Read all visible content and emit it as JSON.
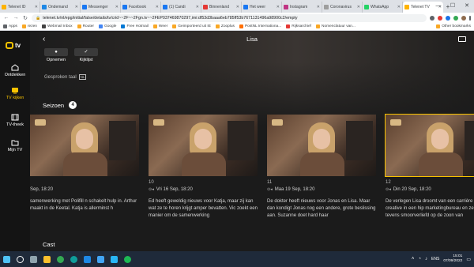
{
  "browser": {
    "tabs": [
      {
        "label": "Telenet ID",
        "color": "#ffb300"
      },
      {
        "label": "Ondemand",
        "color": "#1e88e5"
      },
      {
        "label": "Messenger",
        "color": "#1877f2"
      },
      {
        "label": "Facebook",
        "color": "#1877f2"
      },
      {
        "label": "(1) Candi",
        "color": "#1877f2"
      },
      {
        "label": "Binnenland",
        "color": "#e53935"
      },
      {
        "label": "Het weer",
        "color": "#1877f2"
      },
      {
        "label": "Instagram",
        "color": "#c13584"
      },
      {
        "label": "Coronavirus",
        "color": "#9e9e9e"
      },
      {
        "label": "WhatsApp",
        "color": "#25d366"
      },
      {
        "label": "Telenet TV",
        "color": "#ffb300"
      }
    ],
    "new_tab": "+",
    "window_controls": {
      "minimize": "—",
      "maximize": "☐",
      "close": "✕"
    },
    "url": "telenet.tv/nl/epg/initial/false/details/tv/crid~~2F~~2Fgn.tv~~2FEP037469870297,imi:df53d3baaa6eb785ff53b7671131496a98900c2/empty",
    "bookmarks": [
      {
        "label": "Apps",
        "color": "#5f6368"
      },
      {
        "label": "rezen",
        "color": "#f9a825"
      },
      {
        "label": "Webmail Inbox",
        "color": "#424242"
      },
      {
        "label": "Router",
        "color": "#f9a825"
      },
      {
        "label": "Google",
        "color": "#4285f4"
      },
      {
        "label": "Free Hotmail",
        "color": "#0078d4"
      },
      {
        "label": "Weer",
        "color": "#f9a825"
      },
      {
        "label": "Geimporteerd uit IE",
        "color": "#f9a825"
      },
      {
        "label": "Zooplus",
        "color": "#f9a825"
      },
      {
        "label": "PostNL Internationa...",
        "color": "#ff6f00"
      },
      {
        "label": "Rijksarchief",
        "color": "#e53935"
      },
      {
        "label": "Nomenclatuur van...",
        "color": "#f9a825"
      }
    ],
    "other_bookmarks": "Other bookmarks"
  },
  "app": {
    "logo_text": "tv",
    "accent": "#f8c300",
    "nav": [
      {
        "label": "Ontdekken",
        "icon": "home-icon",
        "active": false
      },
      {
        "label": "TV kijken",
        "icon": "tv-icon",
        "active": true
      },
      {
        "label": "TV-theek",
        "icon": "film-icon",
        "active": false
      },
      {
        "label": "Mijn TV",
        "icon": "folder-icon",
        "active": false
      }
    ],
    "title": "Lisa",
    "actions": [
      {
        "label": "Opnemen",
        "icon": "record-icon",
        "glyph": "●"
      },
      {
        "label": "Kijklijst",
        "icon": "checkmark-icon",
        "glyph": "✓"
      }
    ],
    "spoken_language_label": "Gesproken taal",
    "spoken_language_value": "NL",
    "seasons_label": "Seizoen",
    "seasons_count": "4",
    "episodes": [
      {
        "number": "",
        "date": "Sep, 18:20",
        "description": "samenwerking met Polifill n schakelt hulp in. Arthur maakt in de Keetal. Katja is allerminst h",
        "selected": false
      },
      {
        "number": "10",
        "date": "Vri 16 Sep, 18:20",
        "description": "Ed heeft geweldig nieuws voor Katja, maar zij kan wat ze te horen krijgt amper bevatten. Vic zoekt een manier om de samenwerking",
        "selected": false
      },
      {
        "number": "11",
        "date": "Maa 19 Sep, 18:20",
        "description": "De dokter heeft nieuws voor Jonas en Lisa. Maar dan kondigt Jonas nog een andere, grote beslissing aan. Suzanne doet hard haar",
        "selected": false
      },
      {
        "number": "12",
        "date": "Din 20 Sep, 18:20",
        "description": "De verlegen Lisa droomt van een carrière als creative in een hip marketingbureau en ze wordt tevens smoorverliefd op de zoon van",
        "selected": true
      }
    ],
    "cast_label": "Cast"
  },
  "taskbar": {
    "language": "ENS",
    "time": "15:01",
    "date": "07/09/2022"
  }
}
